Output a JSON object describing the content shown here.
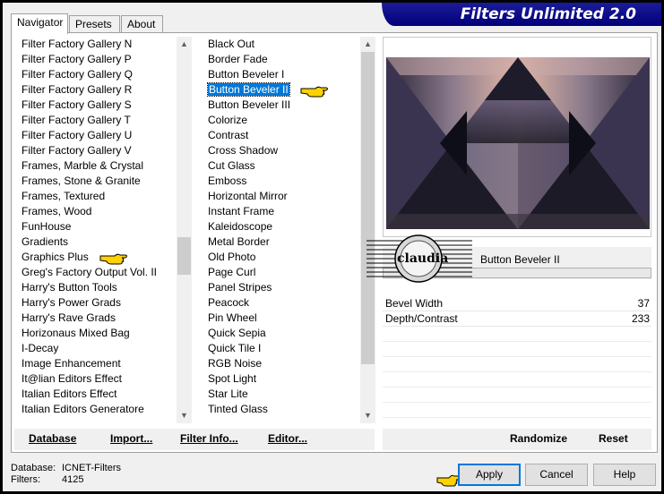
{
  "title": "Filters Unlimited 2.0",
  "tabs": [
    {
      "label": "Navigator"
    },
    {
      "label": "Presets"
    },
    {
      "label": "About"
    }
  ],
  "categories": [
    {
      "label": "Filter Factory Gallery N"
    },
    {
      "label": "Filter Factory Gallery P"
    },
    {
      "label": "Filter Factory Gallery Q"
    },
    {
      "label": "Filter Factory Gallery R"
    },
    {
      "label": "Filter Factory Gallery S"
    },
    {
      "label": "Filter Factory Gallery T"
    },
    {
      "label": "Filter Factory Gallery U"
    },
    {
      "label": "Filter Factory Gallery V"
    },
    {
      "label": "Frames, Marble & Crystal"
    },
    {
      "label": "Frames, Stone & Granite"
    },
    {
      "label": "Frames, Textured"
    },
    {
      "label": "Frames, Wood"
    },
    {
      "label": "FunHouse"
    },
    {
      "label": "Gradients"
    },
    {
      "label": "Graphics Plus"
    },
    {
      "label": "Greg's Factory Output Vol. II"
    },
    {
      "label": "Harry's Button Tools"
    },
    {
      "label": "Harry's Power Grads"
    },
    {
      "label": "Harry's Rave Grads"
    },
    {
      "label": "Horizonaus Mixed Bag"
    },
    {
      "label": "I-Decay"
    },
    {
      "label": "Image Enhancement"
    },
    {
      "label": "It@lian Editors Effect"
    },
    {
      "label": "Italian Editors Effect"
    },
    {
      "label": "Italian Editors Generatore"
    }
  ],
  "filters": [
    {
      "label": "Black Out"
    },
    {
      "label": "Border Fade"
    },
    {
      "label": "Button Beveler I"
    },
    {
      "label": "Button Beveler II"
    },
    {
      "label": "Button Beveler III"
    },
    {
      "label": "Colorize"
    },
    {
      "label": "Contrast"
    },
    {
      "label": "Cross Shadow"
    },
    {
      "label": "Cut Glass"
    },
    {
      "label": "Emboss"
    },
    {
      "label": "Horizontal Mirror"
    },
    {
      "label": "Instant Frame"
    },
    {
      "label": "Kaleidoscope"
    },
    {
      "label": "Metal Border"
    },
    {
      "label": "Old Photo"
    },
    {
      "label": "Page Curl"
    },
    {
      "label": "Panel Stripes"
    },
    {
      "label": "Peacock"
    },
    {
      "label": "Pin Wheel"
    },
    {
      "label": "Quick Sepia"
    },
    {
      "label": "Quick Tile I"
    },
    {
      "label": "RGB Noise"
    },
    {
      "label": "Spot Light"
    },
    {
      "label": "Star Lite"
    },
    {
      "label": "Tinted Glass"
    }
  ],
  "selected_category": "Graphics Plus",
  "selected_filter": "Button Beveler II",
  "stamp_text": "claudia",
  "current_filter": "Button Beveler II",
  "params": [
    {
      "name": "Bevel Width",
      "value": "37"
    },
    {
      "name": "Depth/Contrast",
      "value": "233"
    }
  ],
  "buttons": {
    "database": "Database",
    "import": "Import...",
    "filter_info": "Filter Info...",
    "editor": "Editor...",
    "randomize": "Randomize",
    "reset": "Reset",
    "apply": "Apply",
    "cancel": "Cancel",
    "help": "Help"
  },
  "status": {
    "database_label": "Database:",
    "database_value": "ICNET-Filters",
    "filters_label": "Filters:",
    "filters_value": "4125"
  },
  "icons": {
    "pointer": "pointing-hand-icon",
    "scroll_up": "chevron-up-icon",
    "scroll_down": "chevron-down-icon"
  },
  "colors": {
    "titlebar": "#00007a",
    "selection": "#0078d7",
    "hand": "#ffd200"
  }
}
